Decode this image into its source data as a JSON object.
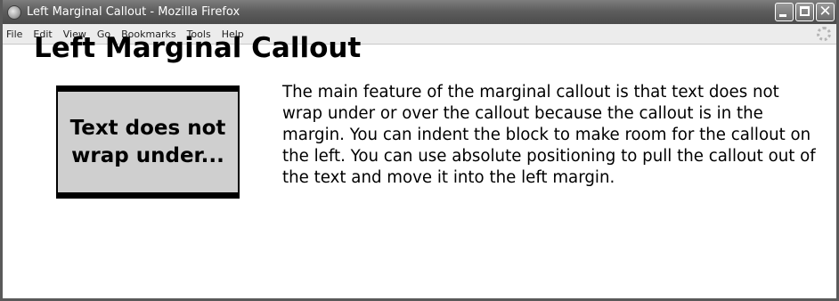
{
  "window": {
    "title": "Left Marginal Callout - Mozilla Firefox",
    "app_icon": "firefox-icon",
    "controls": {
      "minimize_icon": "minimize-icon",
      "maximize_icon": "maximize-icon",
      "close_icon": "close-icon",
      "close_glyph": "✕"
    }
  },
  "menubar": {
    "items": [
      {
        "label": "File"
      },
      {
        "label": "Edit"
      },
      {
        "label": "View"
      },
      {
        "label": "Go"
      },
      {
        "label": "Bookmarks"
      },
      {
        "label": "Tools"
      },
      {
        "label": "Help"
      }
    ],
    "throbber_icon": "throbber-icon"
  },
  "page": {
    "heading": "Left Marginal Callout",
    "callout": "Text does not wrap under...",
    "paragraph": "The main feature of the marginal callout is that text does not wrap under or over the callout because the callout is in the margin. You can indent the block to make room for the callout on the left. You can use absolute positioning to pull the callout out of the text and move it into the left margin."
  }
}
